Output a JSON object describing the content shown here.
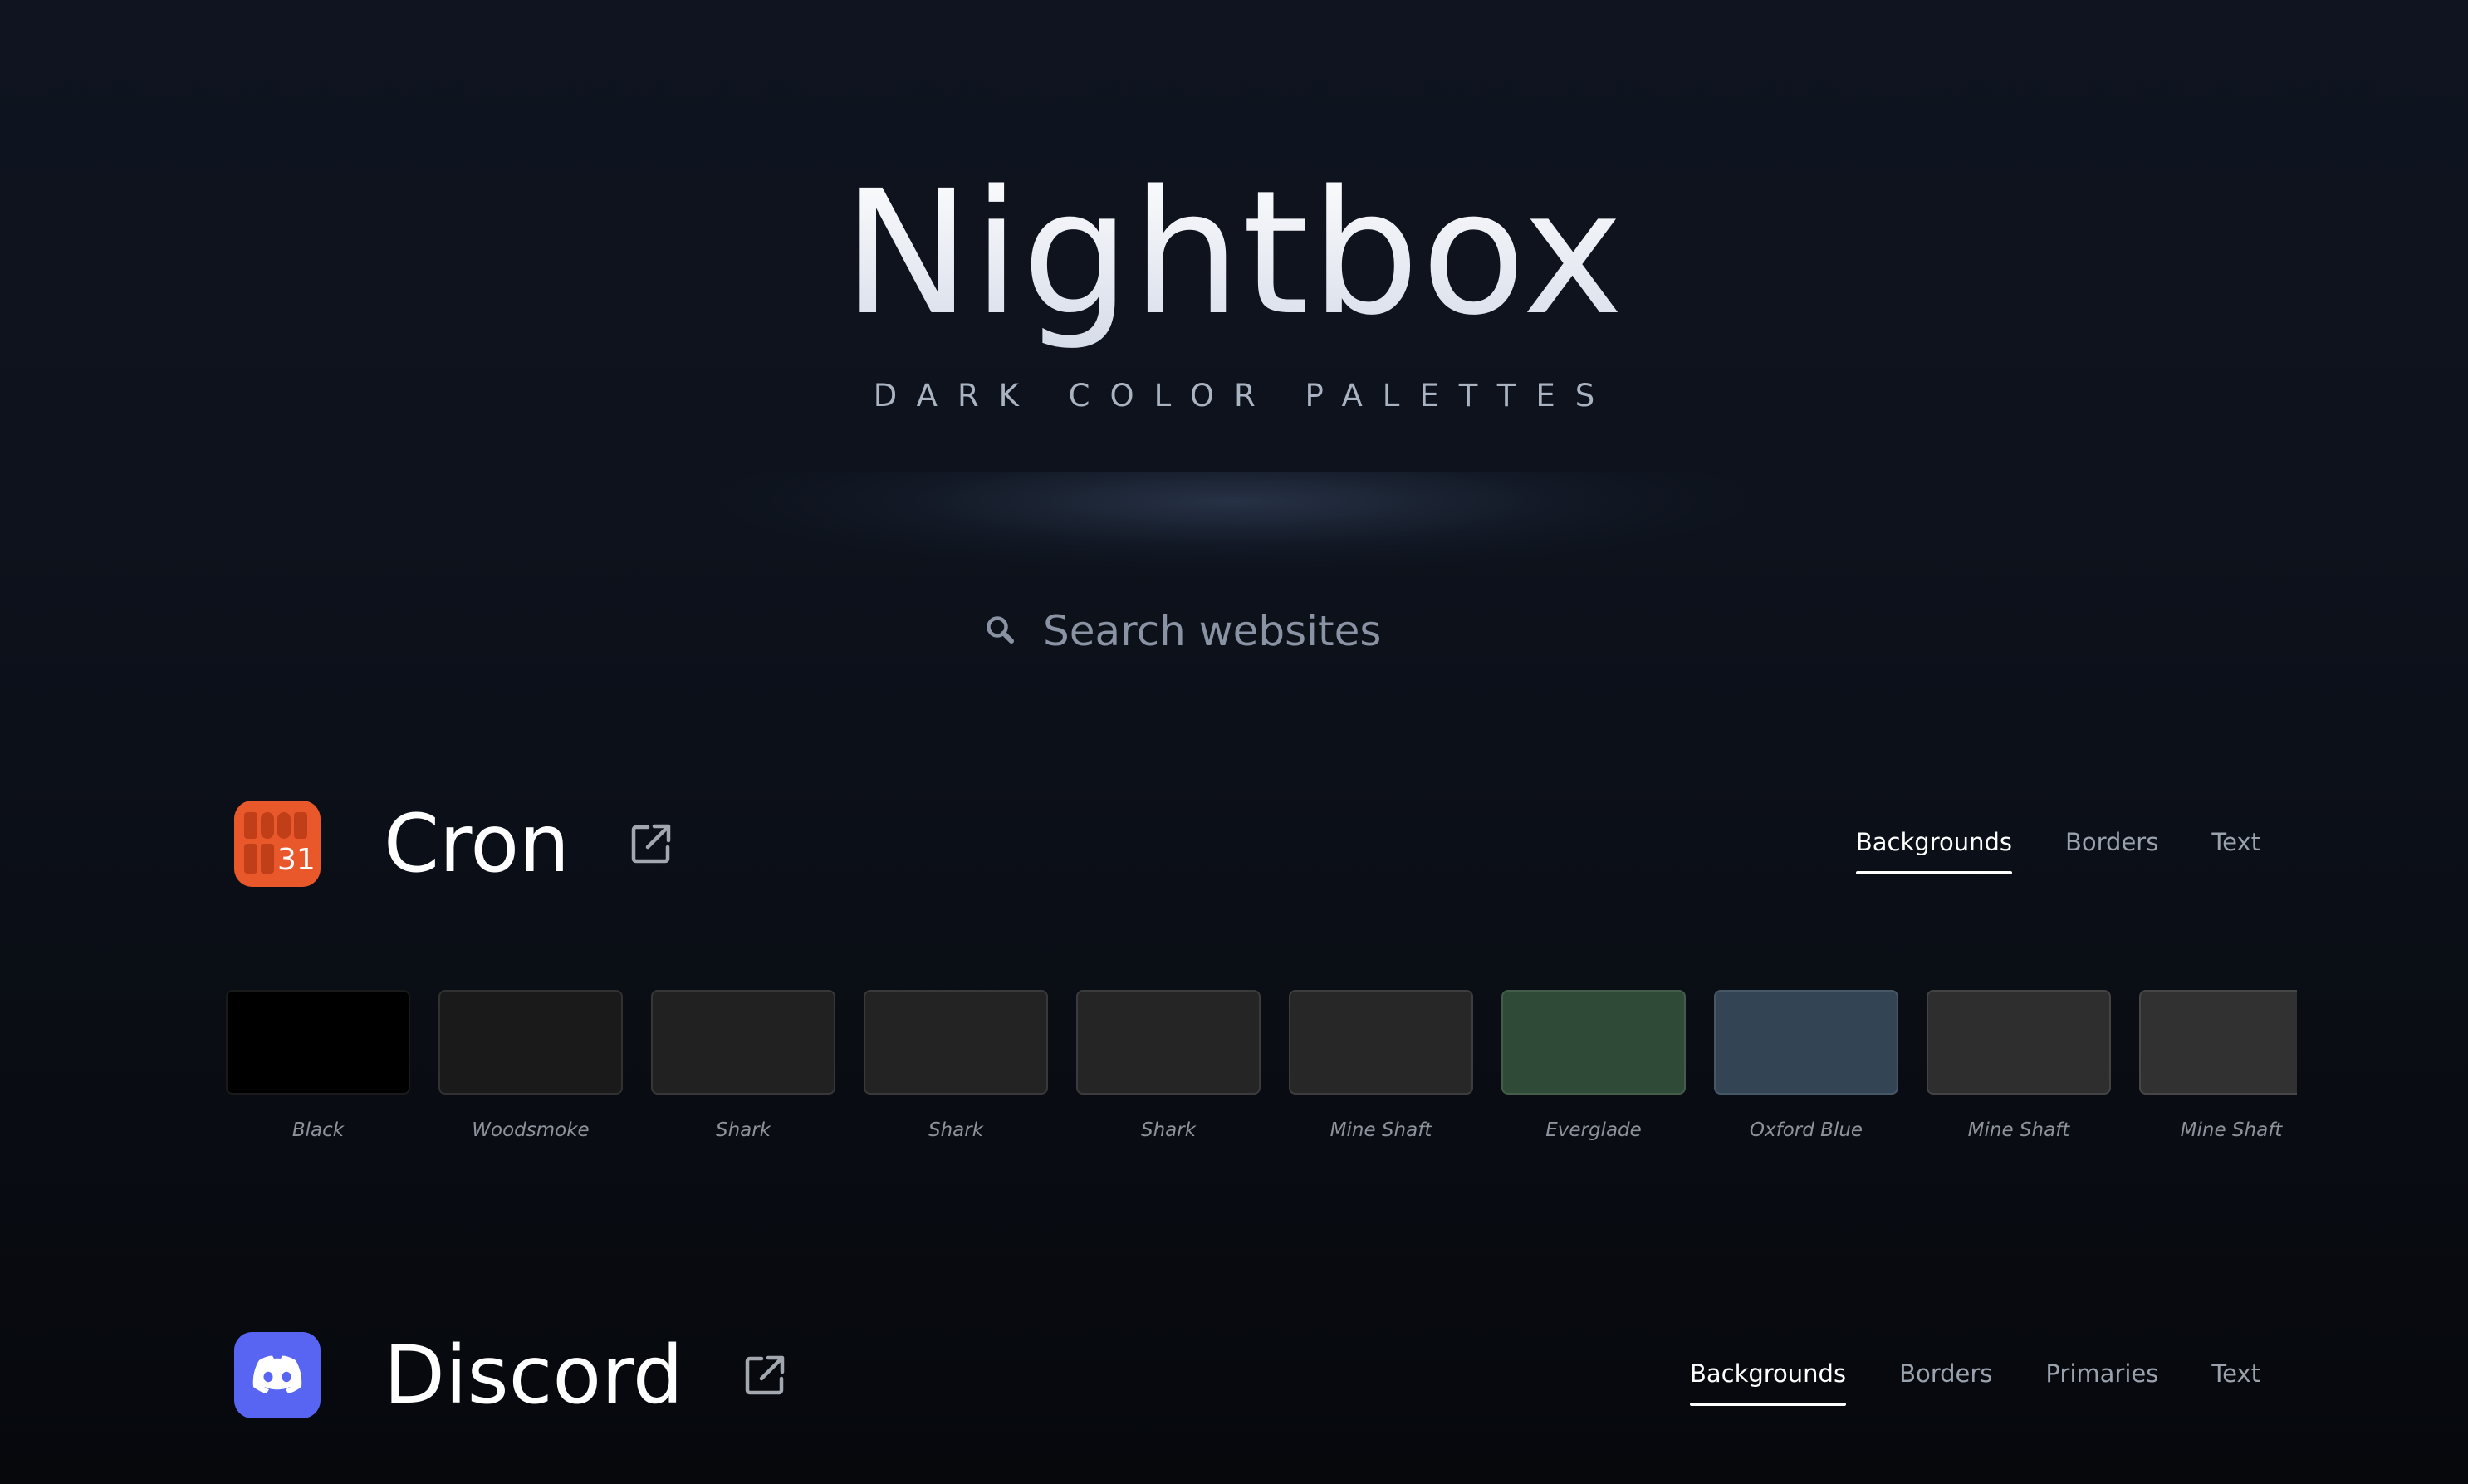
{
  "hero": {
    "title": "Nightbox",
    "subtitle": "DARK COLOR PALETTES"
  },
  "search": {
    "placeholder": "Search websites",
    "icon": "search-icon"
  },
  "sites": [
    {
      "name": "Cron",
      "logo_color": "#e8582b",
      "logo_text": "31",
      "tabs": [
        {
          "label": "Backgrounds",
          "active": true
        },
        {
          "label": "Borders",
          "active": false
        },
        {
          "label": "Text",
          "active": false
        }
      ],
      "swatches": [
        {
          "name": "Black",
          "color": "#000000"
        },
        {
          "name": "Woodsmoke",
          "color": "#1a1a1a"
        },
        {
          "name": "Shark",
          "color": "#212121"
        },
        {
          "name": "Shark",
          "color": "#232323"
        },
        {
          "name": "Shark",
          "color": "#252525"
        },
        {
          "name": "Mine Shaft",
          "color": "#272727"
        },
        {
          "name": "Everglade",
          "color": "#2f4a37"
        },
        {
          "name": "Oxford Blue",
          "color": "#334555"
        },
        {
          "name": "Mine Shaft",
          "color": "#2e2e2e"
        },
        {
          "name": "Mine Shaft",
          "color": "#313131"
        }
      ]
    },
    {
      "name": "Discord",
      "logo_color": "#5865f2",
      "tabs": [
        {
          "label": "Backgrounds",
          "active": true
        },
        {
          "label": "Borders",
          "active": false
        },
        {
          "label": "Primaries",
          "active": false
        },
        {
          "label": "Text",
          "active": false
        }
      ]
    }
  ]
}
